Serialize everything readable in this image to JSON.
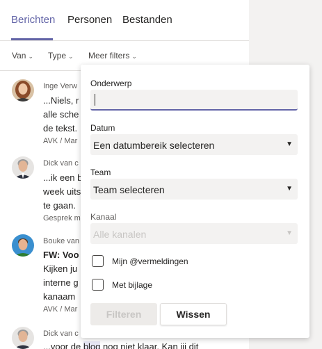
{
  "tabs": [
    {
      "label": "Berichten"
    },
    {
      "label": "Personen"
    },
    {
      "label": "Bestanden"
    }
  ],
  "filters": {
    "van": "Van",
    "type": "Type",
    "meer": "Meer filters"
  },
  "messages": [
    {
      "author": "Inge Verw",
      "lines": [
        "...Niels, r",
        "alle sche",
        "de tekst."
      ],
      "meta": "AVK / Mar"
    },
    {
      "author": "Dick van c",
      "lines": [
        "...ik een b",
        "week uits",
        "te gaan."
      ],
      "meta": "Gesprek m"
    },
    {
      "author": "Bouke van",
      "subject": "FW: Voo",
      "lines": [
        "Kijken ju",
        "interne g",
        "kanaam"
      ],
      "meta": "AVK / Mar"
    },
    {
      "author": "Dick van c",
      "line_prefix": "...voor de ",
      "line_highlight": "blog",
      "line_suffix": " nog niet klaar. Kan jij dit"
    }
  ],
  "popup": {
    "subject_label": "Onderwerp",
    "subject_value": "",
    "date_label": "Datum",
    "date_value": "Een datumbereik selecteren",
    "team_label": "Team",
    "team_value": "Team selecteren",
    "channel_label": "Kanaal",
    "channel_value": "Alle kanalen",
    "mentions_label": "Mijn @vermeldingen",
    "attachment_label": "Met bijlage",
    "filter_button": "Filteren",
    "clear_button": "Wissen"
  },
  "colors": {
    "accent": "#6264a7",
    "background": "#f3f2f1"
  }
}
